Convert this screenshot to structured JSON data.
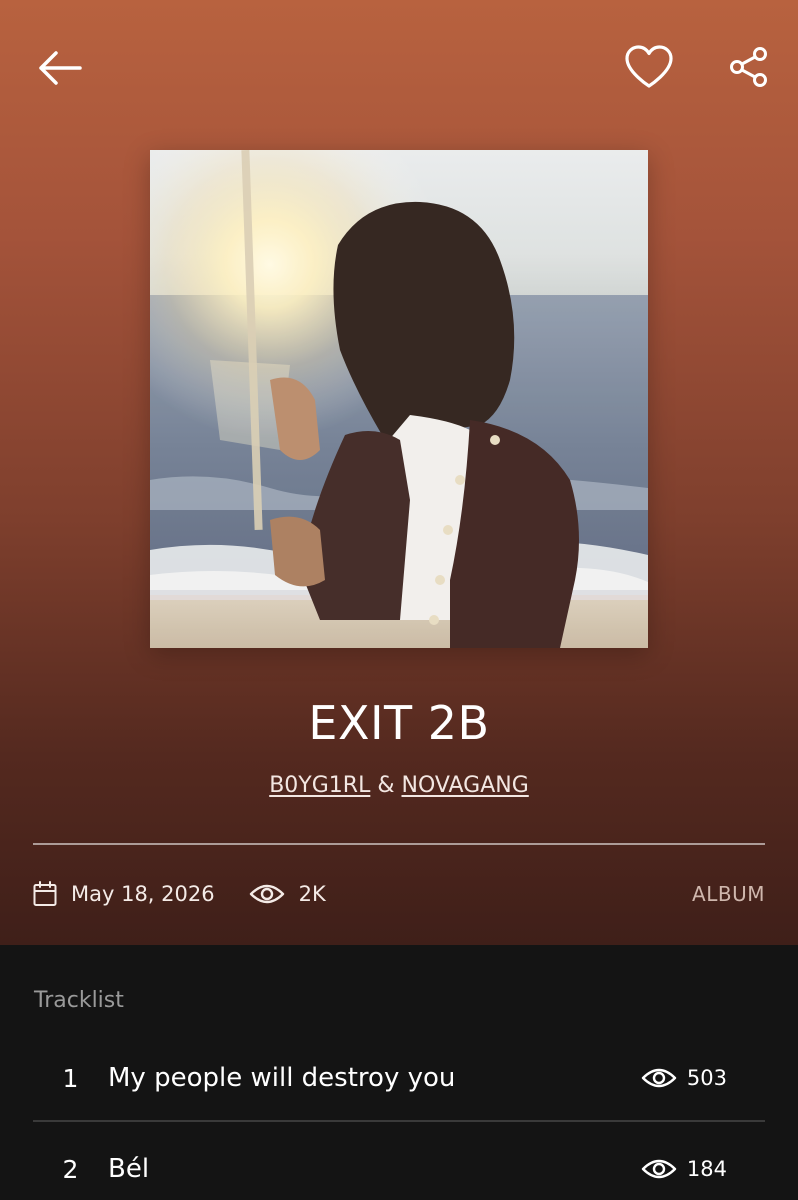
{
  "header": {
    "back_icon": "arrow-left-icon",
    "like_icon": "heart-outline-icon",
    "share_icon": "share-icon"
  },
  "album": {
    "title": "EXIT 2B",
    "artists": [
      {
        "name": "B0YG1RL"
      },
      {
        "name": "NOVAGANG"
      }
    ],
    "artist_separator": "&",
    "release_date": "May 18, 2026",
    "views": "2K",
    "type": "ALBUM"
  },
  "tracklist": {
    "heading": "Tracklist",
    "tracks": [
      {
        "number": "1",
        "title": "My people will destroy you",
        "views": "503"
      },
      {
        "number": "2",
        "title": "Bél",
        "views": "184"
      }
    ]
  },
  "colors": {
    "hero_top": "#b8623f",
    "hero_bottom": "#3f1f19",
    "list_background": "#141414"
  }
}
